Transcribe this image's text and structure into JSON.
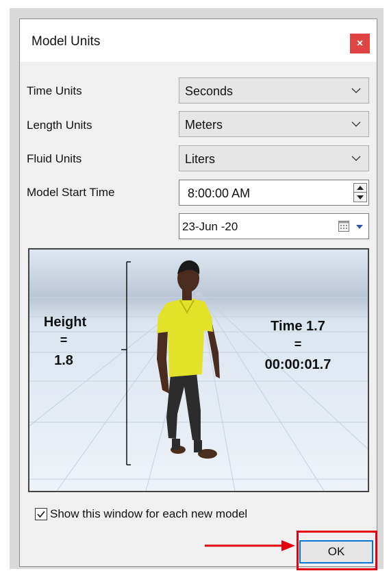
{
  "dialog": {
    "title": "Model Units",
    "close_glyph": "×"
  },
  "fields": {
    "time_units_label": "Time Units",
    "time_units_value": "Seconds",
    "length_units_label": "Length Units",
    "length_units_value": "Meters",
    "fluid_units_label": "Fluid Units",
    "fluid_units_value": "Liters",
    "start_time_label": "Model Start Time",
    "start_time_value": "8:00:00 AM",
    "start_date_value": "23-Jun -20"
  },
  "preview": {
    "height_label": "Height",
    "height_eq": "=",
    "height_value": "1.8",
    "time_label": "Time  1.7",
    "time_eq": "=",
    "time_value": "00:00:01.7"
  },
  "footer": {
    "show_window_label": "Show this window for each new model",
    "show_window_checked": true,
    "ok_label": "OK"
  },
  "colors": {
    "close_button": "#e04343",
    "highlight": "#e3000f",
    "ok_focus": "#0078d7",
    "shirt": "#e2e22a"
  },
  "icons": {
    "close": "close-icon",
    "dropdown": "chevron-down-icon",
    "calendar": "calendar-icon",
    "spin": "spin-arrows-icon",
    "arrow": "red-arrow-annotation"
  }
}
